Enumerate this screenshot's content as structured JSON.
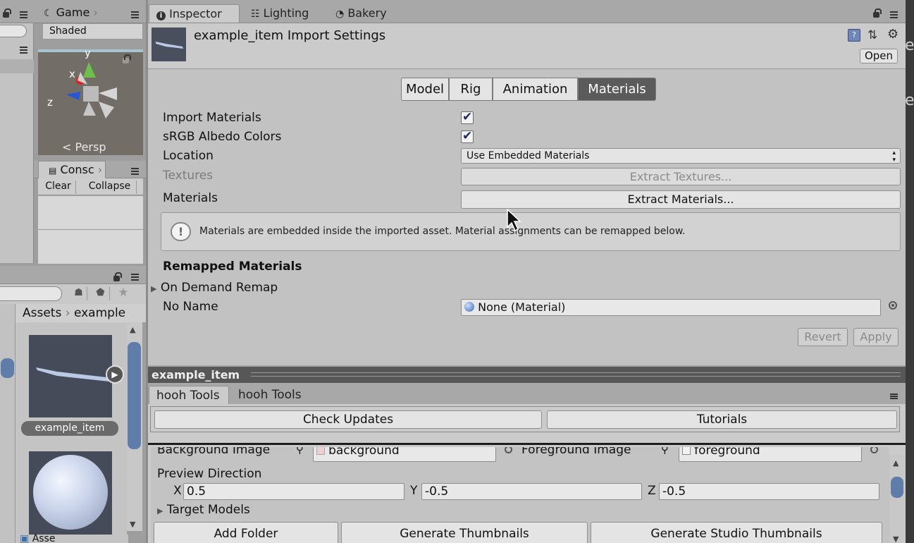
{
  "left_panel": {
    "game_tab": "Game",
    "shaded_label": "Shaded",
    "persp_label": "Persp",
    "gizmo_axes": {
      "y": "y",
      "x": "x",
      "z": "z"
    },
    "console_tab": "Consc",
    "console_buttons": {
      "clear": "Clear",
      "collapse": "Collapse"
    },
    "breadcrumb": {
      "root": "Assets",
      "folder": "example"
    },
    "asset_item_label": "example_item",
    "partial_label": "Asse"
  },
  "inspector": {
    "tabs": {
      "inspector": "Inspector",
      "lighting": "Lighting",
      "bakery": "Bakery"
    },
    "header_title": "example_item Import Settings",
    "open_button": "Open",
    "mode_tabs": {
      "model": "Model",
      "rig": "Rig",
      "animation": "Animation",
      "materials": "Materials"
    },
    "fields": {
      "import_materials": "Import Materials",
      "srgb_albedo": "sRGB Albedo Colors",
      "location": "Location",
      "location_value": "Use Embedded Materials",
      "textures": "Textures",
      "extract_textures": "Extract Textures...",
      "materials": "Materials",
      "extract_materials": "Extract Materials..."
    },
    "info_message": "Materials are embedded inside the imported asset. Material assignments can be remapped below.",
    "remapped_header": "Remapped Materials",
    "on_demand_remap": "On Demand Remap",
    "no_name": "No Name",
    "no_name_value": "None (Material)",
    "revert_button": "Revert",
    "apply_button": "Apply",
    "preview_title": "example_item"
  },
  "hooh": {
    "tab_active": "hooh Tools",
    "tab_other": "hooh Tools",
    "check_updates": "Check Updates",
    "tutorials": "Tutorials",
    "background_image_label": "Background Image",
    "background_value": "background",
    "foreground_image_label": "Foreground Image",
    "foreground_value": "foreground",
    "preview_direction": "Preview Direction",
    "x_label": "X",
    "x_value": "0.5",
    "y_label": "Y",
    "y_value": "-0.5",
    "z_label": "Z",
    "z_value": "-0.5",
    "target_models": "Target Models",
    "add_folder": "Add Folder",
    "generate_thumbnails": "Generate Thumbnails",
    "generate_studio": "Generate Studio Thumbnails"
  },
  "right_edge": {
    "char1": "e",
    "char2": "e"
  }
}
